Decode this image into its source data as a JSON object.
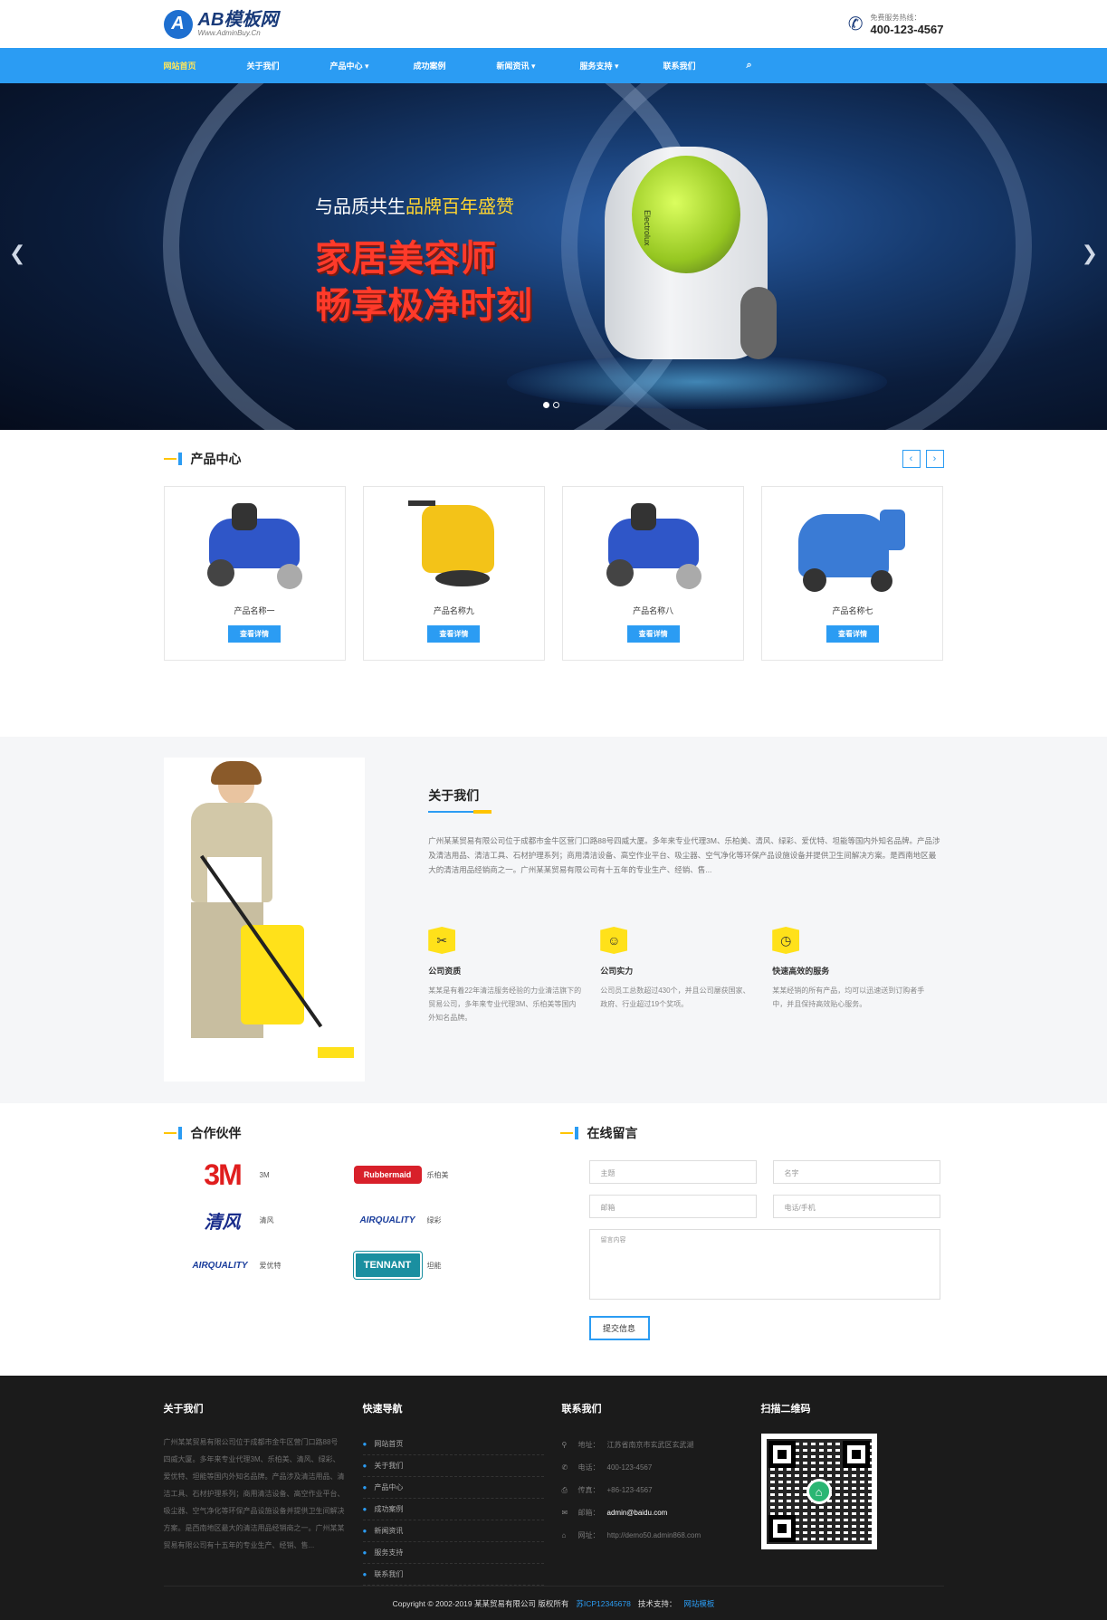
{
  "header": {
    "logo_mark": "A",
    "logo_title": "AB模板网",
    "logo_sub": "Www.AdminBuy.Cn",
    "hotline_label": "免费服务热线：",
    "hotline_number": "400-123-4567"
  },
  "nav": {
    "items": [
      "网站首页",
      "关于我们",
      "产品中心 ▾",
      "成功案例",
      "新闻资讯 ▾",
      "服务支持 ▾",
      "联系我们"
    ],
    "active_index": 0
  },
  "banner": {
    "line1_plain": "与品质共生",
    "line1_highlight": "品牌百年盛赞",
    "line2": "家居美容师",
    "line3": "畅享极净时刻",
    "product_brand": "Electrolux"
  },
  "products": {
    "title": "产品中心",
    "prev": "‹",
    "next": "›",
    "button_label": "查看详情",
    "items": [
      {
        "name": "产品名称一",
        "color": "#2f56c8"
      },
      {
        "name": "产品名称九",
        "color": "#f3c318"
      },
      {
        "name": "产品名称八",
        "color": "#2f56c8"
      },
      {
        "name": "产品名称七",
        "color": "#3a7bd5"
      }
    ]
  },
  "about": {
    "title": "关于我们",
    "description": "广州某某贸易有限公司位于成都市金牛区营门口路88号四威大厦。多年来专业代理3M、乐柏美、清风、绿彩、爱优特、坦能等国内外知名品牌。产品涉及清洁用品、清洁工具、石材护理系列；商用清洁设备、高空作业平台、吸尘器、空气净化等环保产品设施设备并提供卫生间解决方案。是西南地区最大的清洁用品经销商之一。广州某某贸易有限公司有十五年的专业生产、经销、售...",
    "features": [
      {
        "icon": "✂",
        "title": "公司资质",
        "desc": "某某是有着22年清洁服务经验的力业清洁旗下的贸易公司，多年来专业代理3M、乐柏美等国内外知名品牌。"
      },
      {
        "icon": "☺",
        "title": "公司实力",
        "desc": "公司员工总数超过430个，并且公司屡获国家、政府、行业超过19个奖项。"
      },
      {
        "icon": "◷",
        "title": "快速高效的服务",
        "desc": "某某经销的所有产品，均可以迅速送到订购者手中，并且保持高效贴心服务。"
      }
    ]
  },
  "partners": {
    "title": "合作伙伴",
    "items": [
      {
        "logo": "3M",
        "name": "3M",
        "color": "#e01e1e"
      },
      {
        "logo": "Rubbermaid",
        "name": "乐柏美",
        "color": "#d8202a"
      },
      {
        "logo": "清风",
        "name": "清风",
        "color": "#1a2d8c"
      },
      {
        "logo": "AIRQUALITY",
        "name": "绿彩",
        "color": "#1a3d9c"
      },
      {
        "logo": "AIRQUALITY",
        "name": "爱优特",
        "color": "#1a3d9c"
      },
      {
        "logo": "TENNANT",
        "name": "坦能",
        "color": "#1a8fa0"
      }
    ]
  },
  "message": {
    "title": "在线留言",
    "subject_placeholder": "主题",
    "name_placeholder": "名字",
    "email_placeholder": "邮箱",
    "phone_placeholder": "电话/手机",
    "content_placeholder": "留言内容",
    "submit_label": "提交信息"
  },
  "footer": {
    "about_title": "关于我们",
    "about_text": "广州某某贸易有限公司位于成都市金牛区营门口路88号四威大厦。多年来专业代理3M、乐柏美、清风、绿彩、爱优特、坦能等国内外知名品牌。产品涉及清洁用品、清洁工具、石材护理系列；商用清洁设备、高空作业平台、吸尘器、空气净化等环保产品设施设备并提供卫生间解决方案。是西南地区最大的清洁用品经销商之一。广州某某贸易有限公司有十五年的专业生产、经销、售...",
    "nav_title": "快速导航",
    "nav_items": [
      "网站首页",
      "关于我们",
      "产品中心",
      "成功案例",
      "新闻资讯",
      "服务支持",
      "联系我们"
    ],
    "contact_title": "联系我们",
    "contacts": [
      {
        "icon": "⚲",
        "label": "地址：",
        "value": "江苏省南京市玄武区玄武湖"
      },
      {
        "icon": "✆",
        "label": "电话：",
        "value": "400-123-4567"
      },
      {
        "icon": "⎙",
        "label": "传真：",
        "value": "+86-123-4567"
      },
      {
        "icon": "✉",
        "label": "邮箱：",
        "value": "admin@baidu.com"
      },
      {
        "icon": "⌂",
        "label": "网址：",
        "value": "http://demo50.admin868.com"
      }
    ],
    "qr_title": "扫描二维码",
    "copyright": "Copyright © 2002-2019 某某贸易有限公司 版权所有",
    "icp": "苏ICP12345678",
    "tech_label": "技术支持：",
    "tech_link": "网站模板"
  }
}
